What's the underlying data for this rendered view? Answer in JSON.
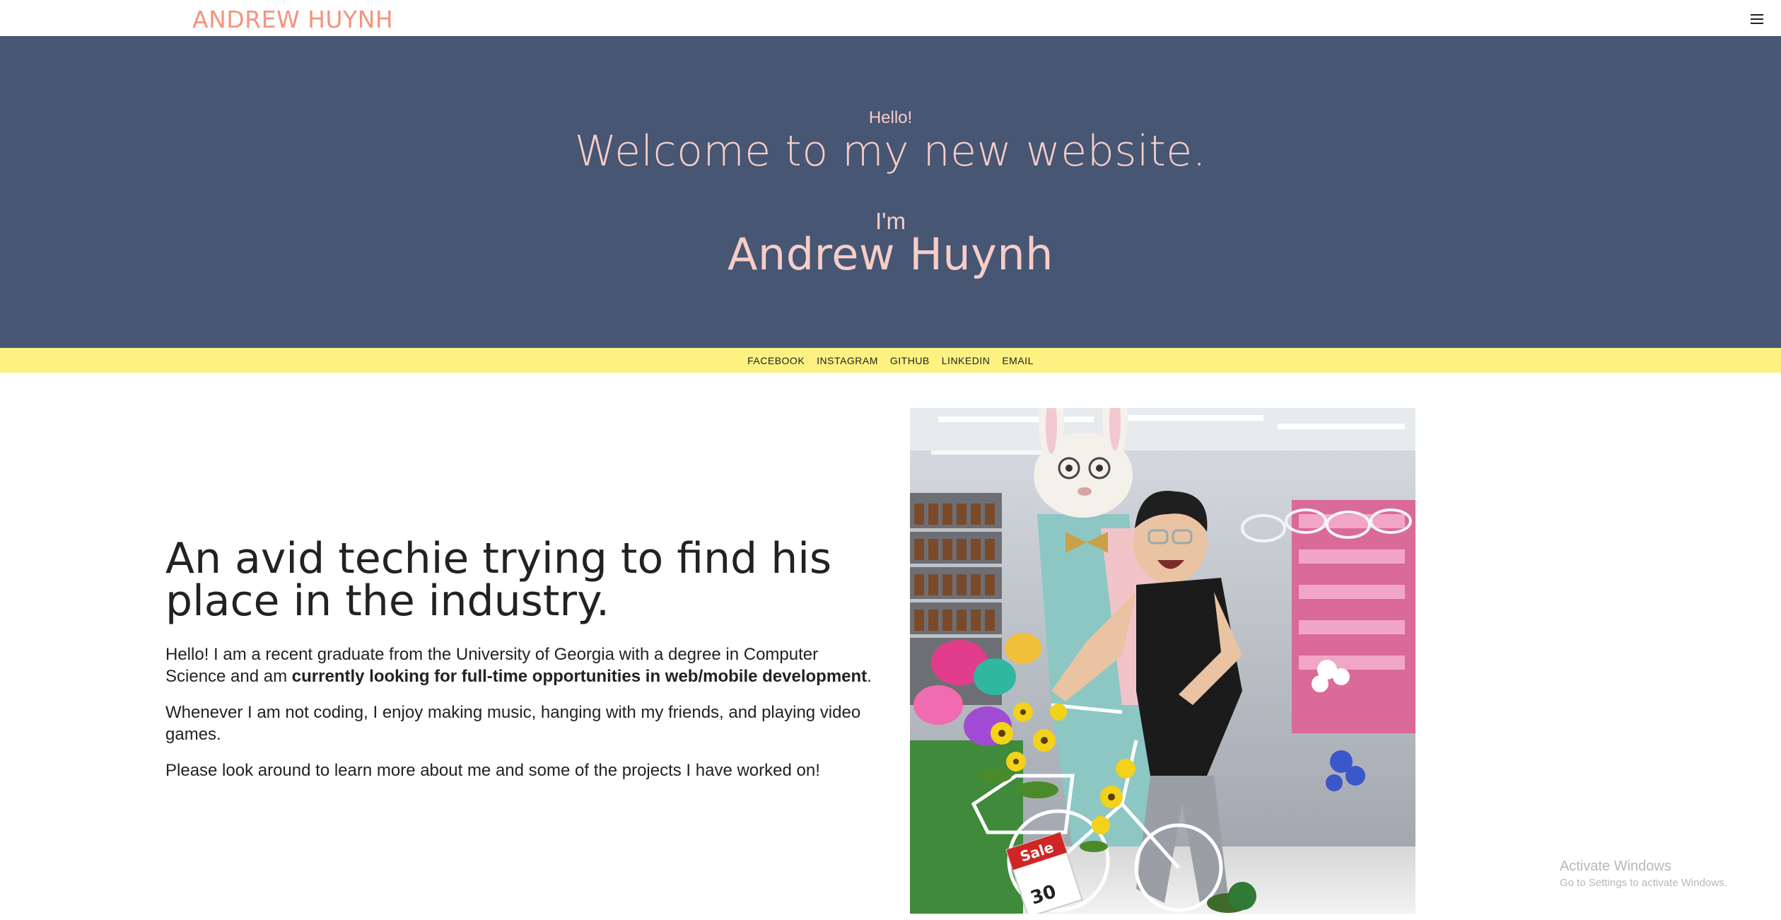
{
  "nav": {
    "brand": "ANDREW HUYNH",
    "menu_icon": "hamburger-menu-icon"
  },
  "hero": {
    "greeting": "Hello!",
    "welcome": "Welcome to my new website.",
    "intro": "I'm",
    "name": "Andrew Huynh"
  },
  "social": {
    "links": [
      "FACEBOOK",
      "INSTAGRAM",
      "GITHUB",
      "LINKEDIN",
      "EMAIL"
    ]
  },
  "about": {
    "heading": "An avid techie trying to find his place in the industry.",
    "p1_start": "Hello! I am a recent graduate from the University of Georgia with a degree in Computer Science and am ",
    "p1_bold": "currently looking for full-time opportunities in web/mobile development",
    "p1_end": ".",
    "p2": "Whenever I am not coding, I enjoy making music, hanging with my friends, and playing video games.",
    "p3": "Please look around to learn more about me and some of the projects I have worked on!"
  },
  "photo": {
    "sale_label": "Sale",
    "price_label": "30"
  },
  "watermark": {
    "line1": "Activate Windows",
    "line2": "Go to Settings to activate Windows."
  },
  "colors": {
    "brand": "#f4937e",
    "hero_bg": "#465673",
    "hero_text": "#f6cdc7",
    "social_bar_bg": "#fdf281"
  }
}
